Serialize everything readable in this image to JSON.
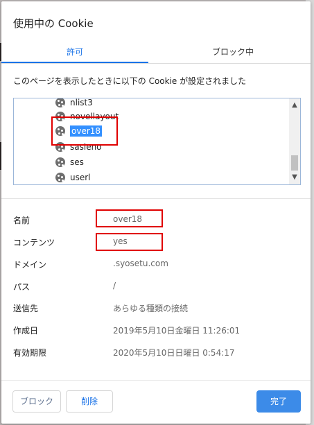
{
  "dialog": {
    "title": "使用中の Cookie",
    "tabs": [
      {
        "label": "許可",
        "active": true
      },
      {
        "label": "ブロック中",
        "active": false
      }
    ],
    "description": "このページを表示したときに以下の Cookie が設定されました",
    "cookie_list": [
      {
        "label": "nlist3",
        "selected": false
      },
      {
        "label": "novellayout",
        "selected": false
      },
      {
        "label": "over18",
        "selected": true
      },
      {
        "label": "sasieno",
        "selected": false
      },
      {
        "label": "ses",
        "selected": false
      },
      {
        "label": "userl",
        "selected": false
      }
    ],
    "details": [
      {
        "label": "名前",
        "value": "over18"
      },
      {
        "label": "コンテンツ",
        "value": "yes"
      },
      {
        "label": "ドメイン",
        "value": ".syosetu.com"
      },
      {
        "label": "パス",
        "value": "/"
      },
      {
        "label": "送信先",
        "value": "あらゆる種類の接続"
      },
      {
        "label": "作成日",
        "value": "2019年5月10日金曜日 11:26:01"
      },
      {
        "label": "有効期限",
        "value": "2020年5月10日日曜日 0:54:17"
      }
    ],
    "buttons": {
      "block": "ブロック",
      "delete": "削除",
      "done": "完了"
    }
  },
  "colors": {
    "accent": "#1a73e8",
    "selection": "#3390ff",
    "annotation_red": "#e00000",
    "primary_button": "#3c8be8"
  }
}
